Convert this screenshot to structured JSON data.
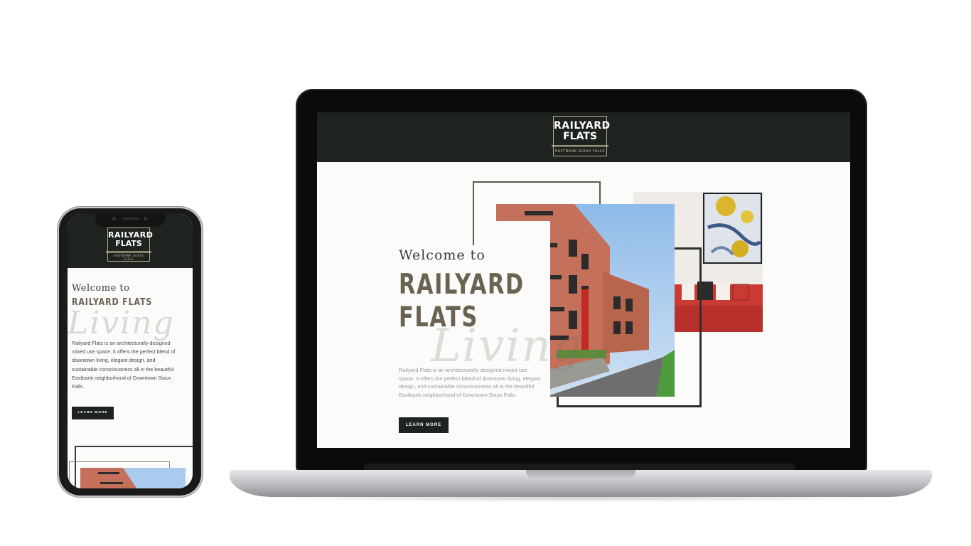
{
  "logo": {
    "line1": "RAILYARD",
    "line2": "FLATS",
    "subline": "EASTBANK SIOUX FALLS"
  },
  "hero": {
    "welcome": "Welcome to",
    "title_line1": "RAILYARD",
    "title_line2": "FLATS",
    "phone_title": "RAILYARD FLATS",
    "script_word": "Living",
    "description": "Railyard Flats is an architecturally designed mixed use space. It offers the perfect blend of downtown living, elegant design, and sustainable consciousness all in the beautiful Eastbank neighborhood of Downtown Sioux Falls.",
    "button_label": "LEARN MORE"
  },
  "colors": {
    "header_bg": "#1e231f",
    "title_color": "#6b6252",
    "logo_border": "#b6a98a",
    "page_bg": "#fbfbfa"
  }
}
